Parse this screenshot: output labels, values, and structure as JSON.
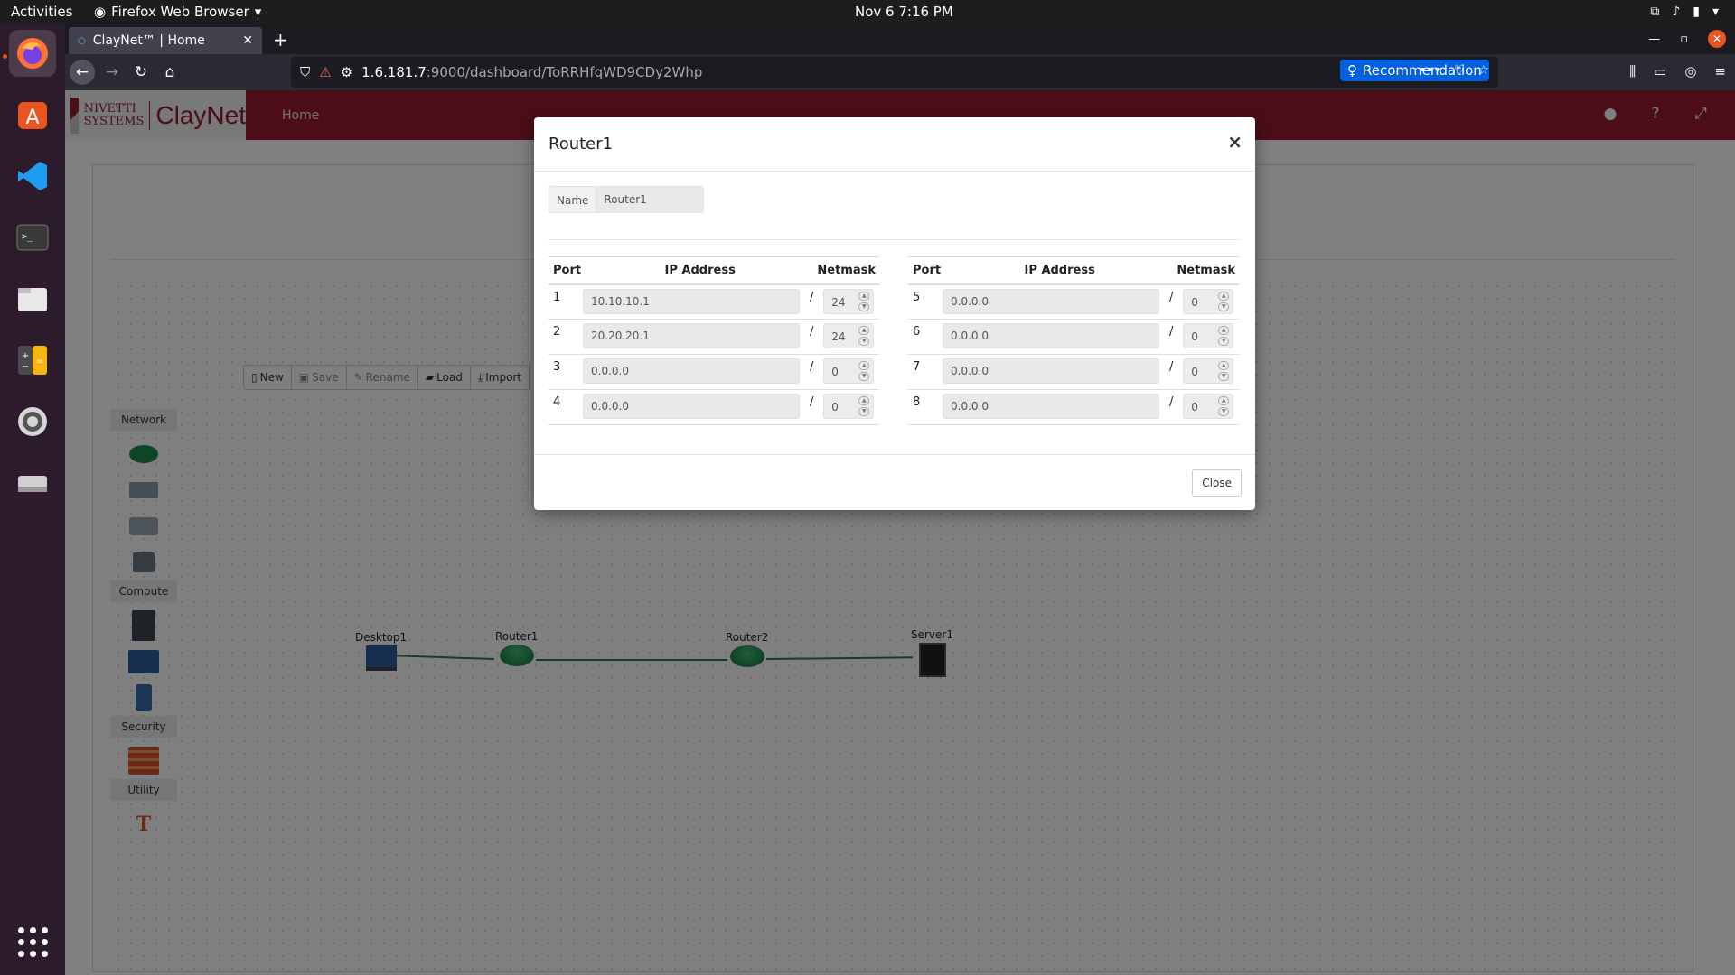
{
  "os_topbar": {
    "activities": "Activities",
    "app_menu": "Firefox Web Browser",
    "clock": "Nov 6  7:16 PM"
  },
  "dock": {
    "items": [
      "firefox-icon",
      "app-center-icon",
      "vscode-icon",
      "terminal-icon",
      "files-icon",
      "calculator-icon",
      "settings-icon",
      "drive-icon",
      "app-grid-icon"
    ]
  },
  "browser": {
    "tab_title": "ClayNet™ | Home",
    "url_host": "1.6.181.7",
    "url_path": ":9000/dashboard/ToRRHfqWD9CDy2Whp",
    "recommendation_label": "Recommendation"
  },
  "app": {
    "logo_top": "NIVETTI",
    "logo_bottom": "SYSTEMS",
    "logo_name": "ClayNet",
    "nav_home": "Home",
    "toolbar": {
      "new": "New",
      "save": "Save",
      "rename": "Rename",
      "load": "Load",
      "import": "Import"
    },
    "palette": {
      "network": "Network",
      "compute": "Compute",
      "security": "Security",
      "utility": "Utility",
      "text_tool": "T"
    },
    "topology": {
      "desktop": "Desktop1",
      "router1": "Router1",
      "router2": "Router2",
      "server": "Server1"
    }
  },
  "modal": {
    "title": "Router1",
    "close_x": "×",
    "name_label": "Name",
    "name_value": "Router1",
    "headers": {
      "port": "Port",
      "ip": "IP Address",
      "mask": "Netmask"
    },
    "left_ports": [
      {
        "port": "1",
        "ip": "10.10.10.1",
        "mask": "24"
      },
      {
        "port": "2",
        "ip": "20.20.20.1",
        "mask": "24"
      },
      {
        "port": "3",
        "ip": "0.0.0.0",
        "mask": "0"
      },
      {
        "port": "4",
        "ip": "0.0.0.0",
        "mask": "0"
      }
    ],
    "right_ports": [
      {
        "port": "5",
        "ip": "0.0.0.0",
        "mask": "0"
      },
      {
        "port": "6",
        "ip": "0.0.0.0",
        "mask": "0"
      },
      {
        "port": "7",
        "ip": "0.0.0.0",
        "mask": "0"
      },
      {
        "port": "8",
        "ip": "0.0.0.0",
        "mask": "0"
      }
    ],
    "slash": "/",
    "close_button": "Close"
  }
}
